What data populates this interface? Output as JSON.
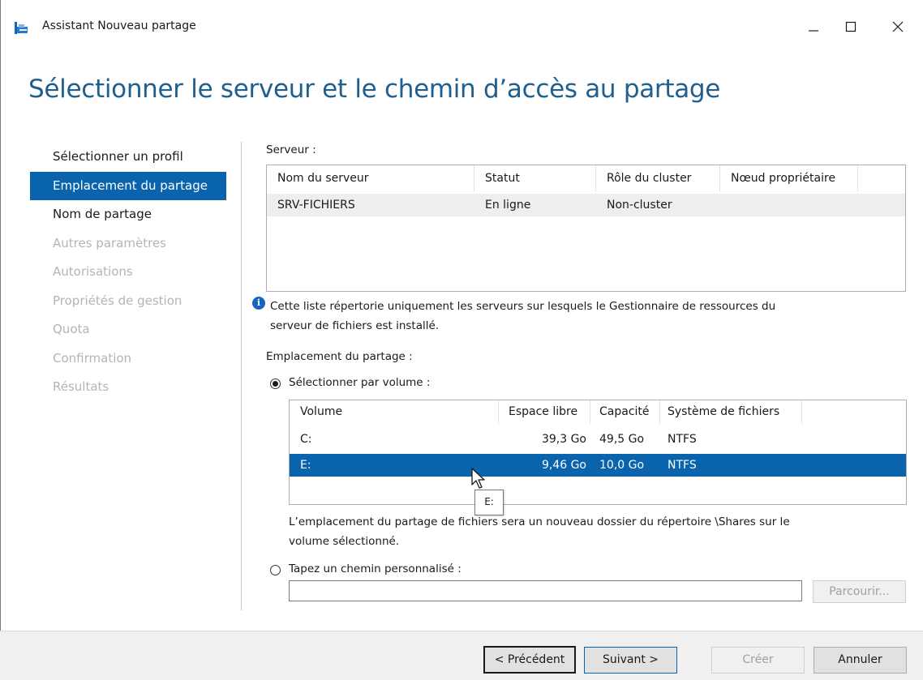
{
  "window": {
    "title": "Assistant Nouveau partage",
    "minimize_glyph": "minimize-icon",
    "maximize_glyph": "maximize-icon",
    "close_glyph": "close-icon"
  },
  "heading": "Sélectionner le serveur et le chemin d’accès au partage",
  "nav": {
    "items": [
      {
        "label": "Sélectionner un profil",
        "state": "normal"
      },
      {
        "label": "Emplacement du partage",
        "state": "current"
      },
      {
        "label": "Nom de partage",
        "state": "normal"
      },
      {
        "label": "Autres paramètres",
        "state": "disabled"
      },
      {
        "label": "Autorisations",
        "state": "disabled"
      },
      {
        "label": "Propriétés de gestion",
        "state": "disabled"
      },
      {
        "label": "Quota",
        "state": "disabled"
      },
      {
        "label": "Confirmation",
        "state": "disabled"
      },
      {
        "label": "Résultats",
        "state": "disabled"
      }
    ]
  },
  "server_section": {
    "label": "Serveur :",
    "columns": [
      "Nom du serveur",
      "Statut",
      "Rôle du cluster",
      "Nœud propriétaire"
    ],
    "rows": [
      {
        "name": "SRV-FICHIERS",
        "status": "En ligne",
        "role": "Non-cluster",
        "owner": ""
      }
    ]
  },
  "info_text_line1": "Cette liste répertorie uniquement les serveurs sur lesquels le Gestionnaire de ressources du",
  "info_text_line2": "serveur de fichiers est installé.",
  "location": {
    "label": "Emplacement du partage :",
    "by_volume_label": "Sélectionner par volume :",
    "by_volume_checked": true,
    "volume_columns": [
      "Volume",
      "Espace libre",
      "Capacité",
      "Système de fichiers"
    ],
    "volumes": [
      {
        "volume": "C:",
        "free": "39,3 Go",
        "capacity": "49,5 Go",
        "fs": "NTFS"
      },
      {
        "volume": "E:",
        "free": "9,46 Go",
        "capacity": "10,0 Go",
        "fs": "NTFS"
      }
    ],
    "selected_volume_index": 1,
    "note_line1": "L’emplacement du partage de fichiers sera un nouveau dossier du répertoire \\Shares sur le",
    "note_line2": "volume sélectionné.",
    "custom_path_label": "Tapez un chemin personnalisé :",
    "custom_path_checked": false,
    "custom_path_value": "",
    "browse_label": "Parcourir..."
  },
  "tooltip": "E:",
  "footer": {
    "previous": "< Précédent",
    "next": "Suivant >",
    "create": "Créer",
    "cancel": "Annuler"
  }
}
